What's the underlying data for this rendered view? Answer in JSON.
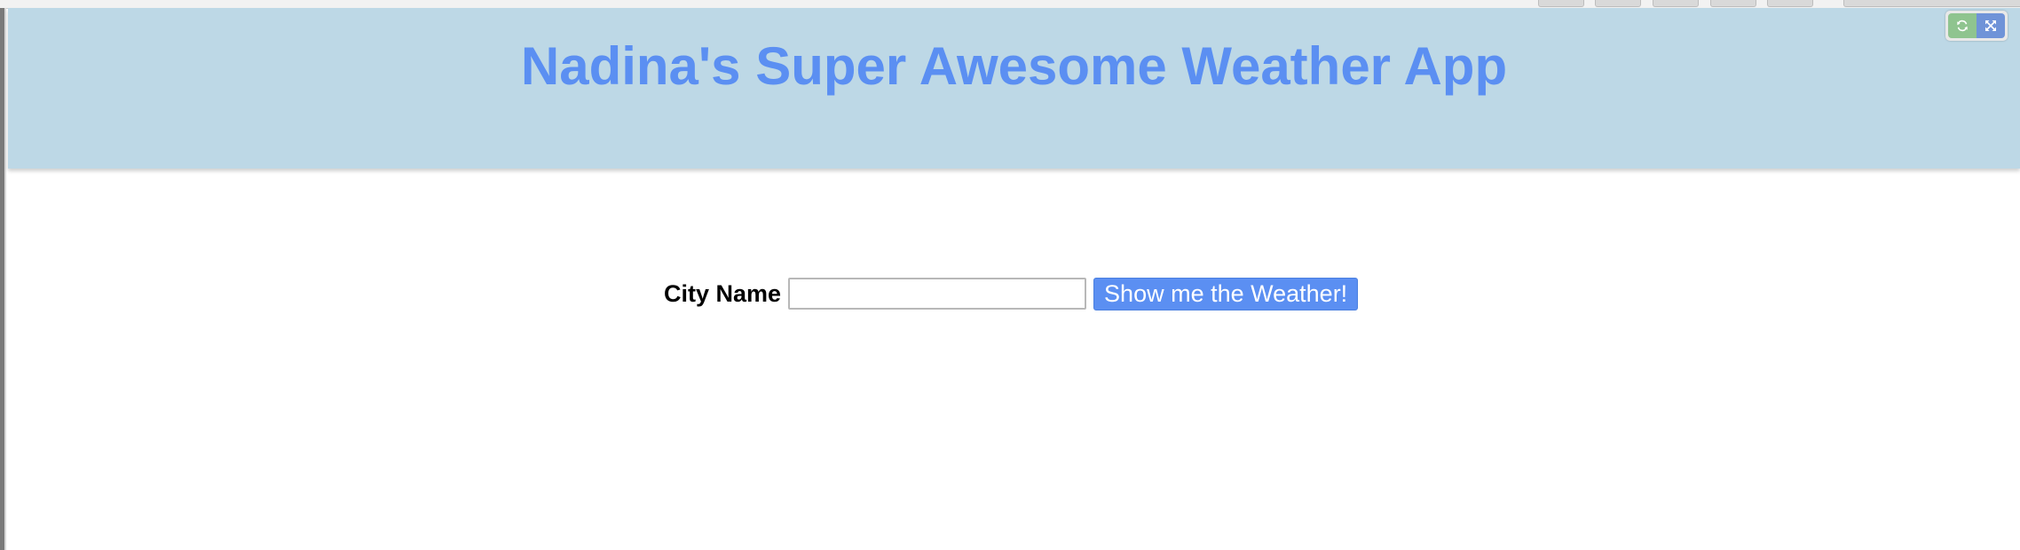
{
  "header": {
    "title": "Nadina's Super Awesome Weather App"
  },
  "controls": {
    "refresh_icon": "refresh-icon",
    "expand_icon": "expand-icon"
  },
  "form": {
    "city_label": "City Name",
    "city_input_value": "",
    "city_input_placeholder": "",
    "submit_label": "Show me the Weather!"
  },
  "colors": {
    "header_background": "#bdd8e6",
    "title_color": "#5b8ff2",
    "button_background": "#5b8ff2",
    "refresh_button": "#8fc48f",
    "expand_button": "#6f93d8"
  }
}
